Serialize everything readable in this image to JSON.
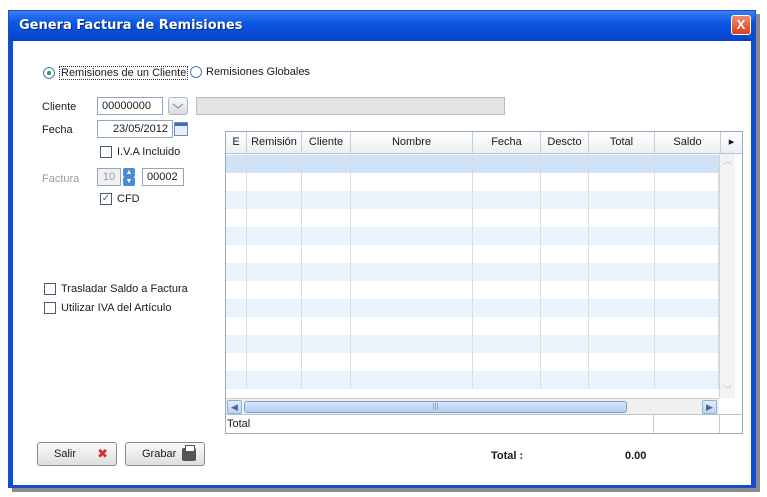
{
  "window": {
    "title": "Genera Factura de Remisiones",
    "close_symbol": "X"
  },
  "mode": {
    "option_cliente": "Remisiones de un Cliente",
    "option_globales": "Remisiones Globales",
    "selected": "Remisiones de un Cliente"
  },
  "form": {
    "cliente_label": "Cliente",
    "cliente_value": "00000000",
    "cliente_nombre": "",
    "fecha_label": "Fecha",
    "fecha_value": "23/05/2012",
    "iva_incluido_label": "I.V.A Incluido",
    "iva_incluido_checked": false,
    "factura_label": "Factura",
    "factura_serie": "10",
    "factura_folio": "00002",
    "cfd_label": "CFD",
    "cfd_checked": true,
    "trasladar_label": "Trasladar Saldo a Factura",
    "trasladar_checked": false,
    "utilizar_iva_label": "Utilizar IVA del Artículo",
    "utilizar_iva_checked": false
  },
  "grid": {
    "columns": [
      "E",
      "Remisión",
      "Cliente",
      "Nombre",
      "Fecha",
      "Descto",
      "Total",
      "Saldo"
    ],
    "rows": [],
    "footer_label": "Total"
  },
  "buttons": {
    "salir": "Salir",
    "grabar": "Grabar"
  },
  "summary": {
    "total_label": "Total :",
    "total_value": "0.00"
  },
  "colors": {
    "title_bar": "#0b56e3",
    "selected_row": "#cfe2f7",
    "alt_row": "#eaf2fb",
    "check_mark": "#1f8a2a"
  }
}
